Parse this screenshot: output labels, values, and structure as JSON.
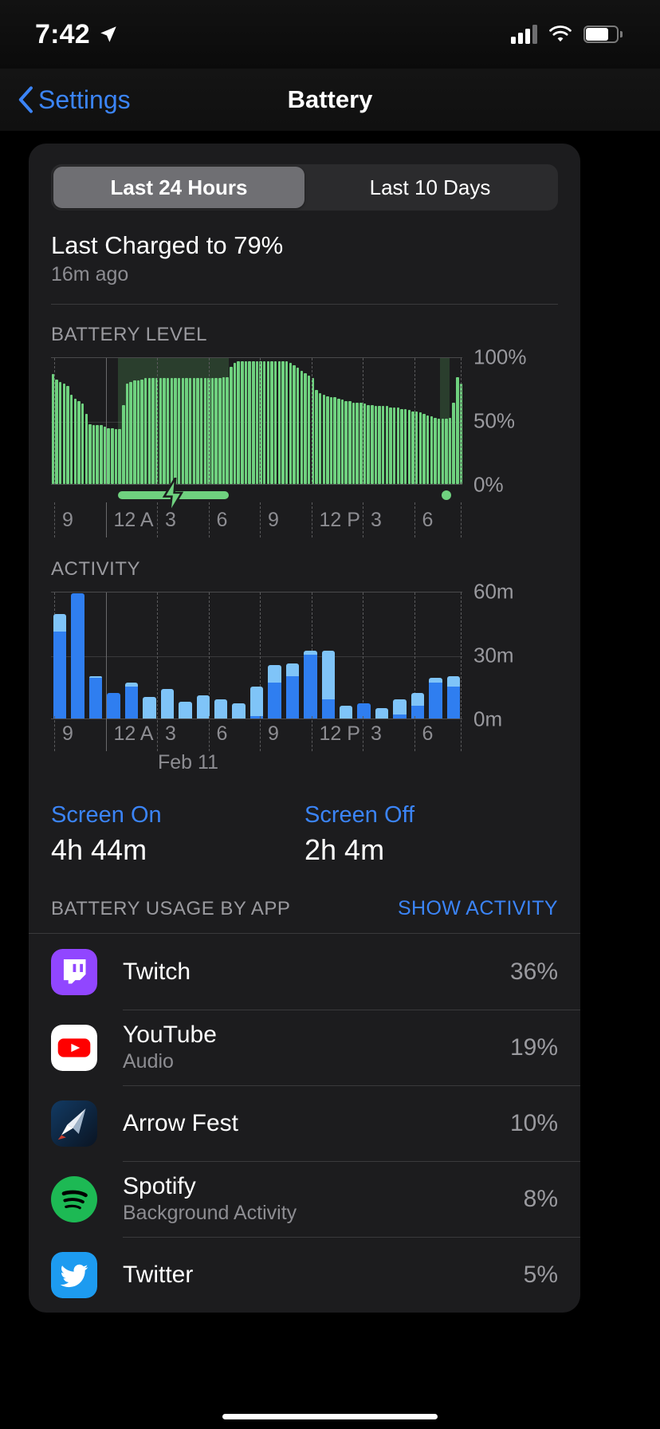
{
  "status_bar": {
    "time": "7:42",
    "location_icon": "location-arrow-icon",
    "cellular_icon": "signal-bars-icon",
    "wifi_icon": "wifi-icon",
    "battery_icon": "battery-icon"
  },
  "nav": {
    "back_label": "Settings",
    "title": "Battery",
    "back_icon": "chevron-left-icon"
  },
  "segmented": {
    "options": [
      "Last 24 Hours",
      "Last 10 Days"
    ],
    "selected_index": 0
  },
  "charged": {
    "title": "Last Charged to 79%",
    "subtitle": "16m ago"
  },
  "battery_level": {
    "section_label": "BATTERY LEVEL",
    "y_labels": [
      "100%",
      "50%",
      "0%"
    ],
    "x_labels": [
      "9",
      "12 A",
      "3",
      "6",
      "9",
      "12 P",
      "3",
      "6"
    ],
    "charging_icon": "lightning-bolt-icon"
  },
  "activity": {
    "section_label": "ACTIVITY",
    "y_labels": [
      "60m",
      "30m",
      "0m"
    ],
    "x_labels": [
      "9",
      "12 A",
      "3",
      "6",
      "9",
      "12 P",
      "3",
      "6"
    ],
    "day_label": "Feb 11"
  },
  "screen_times": [
    {
      "label": "Screen On",
      "value": "4h 44m"
    },
    {
      "label": "Screen Off",
      "value": "2h 4m"
    }
  ],
  "usage": {
    "title": "BATTERY USAGE BY APP",
    "action": "SHOW ACTIVITY"
  },
  "apps": [
    {
      "name": "Twitch",
      "subtitle": "",
      "percent": "36%",
      "icon": "twitch-icon",
      "color": "#9146ff"
    },
    {
      "name": "YouTube",
      "subtitle": "Audio",
      "percent": "19%",
      "icon": "youtube-icon",
      "color": "#ffffff"
    },
    {
      "name": "Arrow Fest",
      "subtitle": "",
      "percent": "10%",
      "icon": "arrowfest-icon",
      "color": "#10243f"
    },
    {
      "name": "Spotify",
      "subtitle": "Background Activity",
      "percent": "8%",
      "icon": "spotify-icon",
      "color": "#1db954"
    },
    {
      "name": "Twitter",
      "subtitle": "",
      "percent": "5%",
      "icon": "twitter-icon",
      "color": "#1d9bf0"
    }
  ],
  "colors": {
    "accent": "#3b84f7",
    "battery_green": "#6fd17f",
    "charge_shade": "#3b5e3f",
    "screen_on_blue": "#2f7ef0",
    "screen_off_blue": "#7fc4f8",
    "card_bg": "#1c1c1e",
    "page_bg": "#000000"
  },
  "chart_data": [
    {
      "type": "bar",
      "title": "BATTERY LEVEL",
      "xlabel": "",
      "ylabel": "Battery %",
      "ylim": [
        0,
        100
      ],
      "ytick_labels": [
        "100%",
        "50%",
        "0%"
      ],
      "ytick_values": [
        100,
        50,
        0
      ],
      "xtick_labels": [
        "9",
        "12 A",
        "3",
        "6",
        "9",
        "12 P",
        "3",
        "6"
      ],
      "grid": true,
      "series_color": "#6fd17f",
      "values": [
        86,
        82,
        80,
        79,
        77,
        70,
        67,
        65,
        63,
        55,
        47,
        46,
        46,
        46,
        45,
        44,
        44,
        43,
        43,
        62,
        79,
        80,
        81,
        81,
        82,
        83,
        83,
        83,
        83,
        83,
        83,
        83,
        83,
        83,
        83,
        83,
        83,
        83,
        83,
        83,
        83,
        83,
        83,
        83,
        83,
        83,
        84,
        84,
        92,
        95,
        96,
        96,
        96,
        96,
        96,
        96,
        96,
        96,
        96,
        96,
        96,
        96,
        96,
        96,
        95,
        93,
        91,
        89,
        87,
        85,
        83,
        74,
        71,
        70,
        69,
        68,
        68,
        67,
        66,
        65,
        65,
        64,
        64,
        64,
        63,
        62,
        62,
        61,
        61,
        61,
        61,
        60,
        60,
        60,
        59,
        59,
        58,
        57,
        57,
        56,
        55,
        54,
        53,
        52,
        51,
        51,
        51,
        52,
        64,
        84,
        79
      ],
      "charging_intervals": [
        {
          "start_index": 18,
          "end_index": 47,
          "label": "charging"
        },
        {
          "start_index": 105,
          "end_index": 107,
          "label": "charging"
        }
      ],
      "annotations": [
        "lightning-bolt charging marker"
      ]
    },
    {
      "type": "bar",
      "stacked": true,
      "title": "ACTIVITY",
      "xlabel": "",
      "ylabel": "minutes",
      "ylim": [
        0,
        60
      ],
      "ytick_labels": [
        "60m",
        "30m",
        "0m"
      ],
      "ytick_values": [
        60,
        30,
        0
      ],
      "xtick_labels": [
        "9",
        "12 A",
        "3",
        "6",
        "9",
        "12 P",
        "3",
        "6"
      ],
      "day_annotation": "Feb 11",
      "grid": true,
      "series": [
        {
          "name": "Screen On",
          "color": "#2f7ef0",
          "values": [
            41,
            59,
            19,
            12,
            15,
            0,
            0,
            0,
            0,
            0,
            0,
            1,
            17,
            20,
            30,
            9,
            0,
            7,
            0,
            2,
            6,
            17,
            15
          ]
        },
        {
          "name": "Screen Off",
          "color": "#7fc4f8",
          "values": [
            8,
            0,
            1,
            0,
            2,
            10,
            14,
            8,
            11,
            9,
            7,
            14,
            8,
            6,
            2,
            23,
            6,
            0,
            5,
            7,
            6,
            2,
            5
          ]
        }
      ]
    }
  ]
}
